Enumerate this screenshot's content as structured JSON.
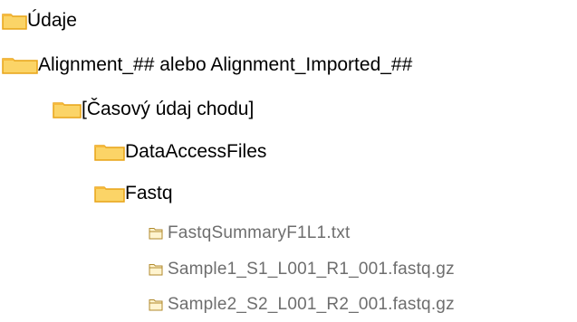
{
  "tree": {
    "items": [
      {
        "label": "Údaje",
        "kind": "folder"
      },
      {
        "label": "Alignment_## alebo Alignment_Imported_##",
        "kind": "folder"
      },
      {
        "label": "[Časový údaj chodu]",
        "kind": "folder"
      },
      {
        "label": "DataAccessFiles",
        "kind": "folder"
      },
      {
        "label": "Fastq",
        "kind": "folder"
      },
      {
        "label": "FastqSummaryF1L1.txt",
        "kind": "file"
      },
      {
        "label": "Sample1_S1_L001_R1_001.fastq.gz",
        "kind": "file"
      },
      {
        "label": "Sample2_S2_L001_R2_001.fastq.gz",
        "kind": "file"
      }
    ]
  },
  "colors": {
    "folder_fill": "#fbd467",
    "folder_tab": "#f6b93b",
    "folder_outline": "#e8a317",
    "file_folder_fill": "#fff4cf",
    "file_folder_outline": "#b08a2e",
    "text_main": "#000000",
    "text_file": "#6e6e6e"
  },
  "icons": {
    "folder": "folder-icon",
    "file": "file-folder-icon"
  }
}
